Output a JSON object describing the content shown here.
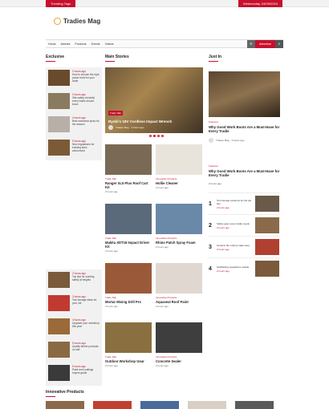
{
  "topbar": {
    "left_label": "Trending Tags",
    "right_label": "Wednesday, 04/09/2024"
  },
  "brand": {
    "name": "Tradies Mag"
  },
  "nav": {
    "items": [
      "Home",
      "Articles",
      "Products",
      "Events",
      "Videos"
    ],
    "cta": "Advertise",
    "search_icon": "search-icon"
  },
  "sections": {
    "exclusive": "Exclusive",
    "main": "Main Stories",
    "just_in": "Just In",
    "innovative": "Innovative Products"
  },
  "exclusive_top": [
    {
      "cat": "2 hours ago",
      "text": "How to choose the right power tools for your trade"
    },
    {
      "cat": "3 hours ago",
      "text": "Site safety checklist every tradie should know"
    },
    {
      "cat": "4 hours ago",
      "text": "Best workwear picks for the season"
    },
    {
      "cat": "5 hours ago",
      "text": "New regulations for building sites announced"
    }
  ],
  "exclusive_bottom": [
    {
      "cat": "2 hours ago",
      "text": "Top tips for working safely at heights"
    },
    {
      "cat": "3 hours ago",
      "text": "Tool storage ideas for your ute"
    },
    {
      "cat": "4 hours ago",
      "text": "Upgrade your workshop this year"
    },
    {
      "cat": "5 hours ago",
      "text": "Quality timber products on site"
    },
    {
      "cat": "6 hours ago",
      "text": "Paint and coatings buyers guide"
    }
  ],
  "hero": {
    "tag": "Trade Talk",
    "title": "Ryobi's 18V Cordless Impact Wrench",
    "author": "Tradies Mag",
    "date": "2 hours ago"
  },
  "cards": [
    {
      "cat": "Trade Talk",
      "title": "Ranger XL5 Plus Roof Cart Kit",
      "date": "2 hours ago"
    },
    {
      "cat": "Innovative Products",
      "title": "Hollie Cleaner",
      "date": "2 hours ago"
    },
    {
      "cat": "Trade Talk",
      "title": "Makita XDT16 Impact Driver Kit",
      "date": "2 hours ago"
    },
    {
      "cat": "Innovative Products",
      "title": "Rhino Patch Spray Foam",
      "date": "2 hours ago"
    },
    {
      "cat": "Trade Talk",
      "title": "Mortar Mixing Drill Pro",
      "date": "2 hours ago"
    },
    {
      "cat": "Innovative Products",
      "title": "Aquaseal Roof Paint",
      "date": "2 hours ago"
    },
    {
      "cat": "Trade Talk",
      "title": "Outdoor Workshop Gear",
      "date": "2 hours ago"
    },
    {
      "cat": "Innovative Products",
      "title": "Concrete Sealer",
      "date": "2 hours ago"
    }
  ],
  "just_in": {
    "cat": "Features",
    "title": "Why Good Work Boots Are a Must-Have for Every Tradie",
    "author": "Tradies Mag",
    "date": "2 hours ago",
    "cat2": "Features",
    "title2": "Why Good Work Boots Are a Must-Have for Every Tradie",
    "date2": "2 hours ago",
    "list": [
      {
        "num": "1",
        "text": "Tool storage solutions for the job site",
        "date": "2 hours ago"
      },
      {
        "num": "2",
        "text": "Safety gear every tradie needs",
        "date": "2 hours ago"
      },
      {
        "num": "3",
        "text": "Ceramic tile cutting made easy",
        "date": "2 hours ago"
      },
      {
        "num": "4",
        "text": "Scaffolding regulations update",
        "date": "2 hours ago"
      }
    ]
  }
}
